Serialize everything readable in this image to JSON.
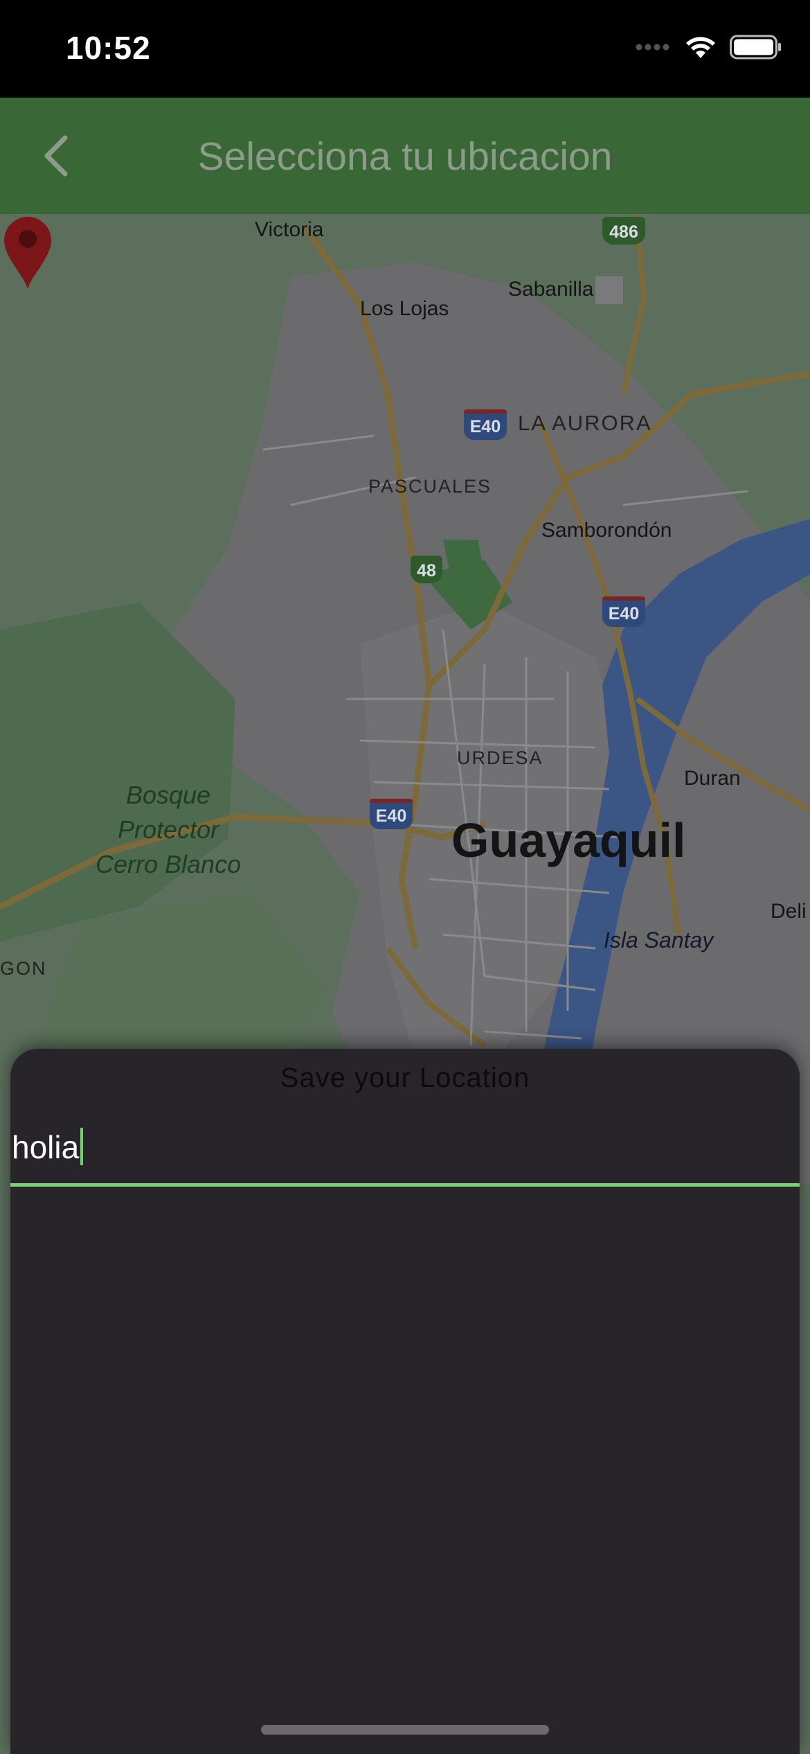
{
  "status_bar": {
    "time": "10:52",
    "icons": [
      "signal-dots-icon",
      "wifi-icon",
      "battery-icon"
    ]
  },
  "app_bar": {
    "title": "Selecciona tu ubicacion",
    "back_icon": "chevron-left-icon",
    "color": "#396836"
  },
  "map": {
    "place_labels": {
      "victoria": "Victoria",
      "sabanilla": "Sabanilla",
      "los_lojas": "Los Lojas",
      "la_aurora": "LA AURORA",
      "pascuales": "PASCUALES",
      "samborondon": "Samborondón",
      "urdesa": "URDESA",
      "duran": "Duran",
      "guayaquil": "Guayaquil",
      "bosque": "Bosque\nProtector\nCerro Blanco",
      "isla_santay": "Isla Santay",
      "deli": "Deli",
      "gon": "GON"
    },
    "shields": {
      "e40_a": "E40",
      "e40_b": "E40",
      "e40_c": "E40",
      "r48": "48",
      "r486": "486"
    },
    "marker_icon": "map-pin-icon"
  },
  "sheet": {
    "title": "Save your Location",
    "input_value": "holia",
    "accent": "#76d56f"
  }
}
